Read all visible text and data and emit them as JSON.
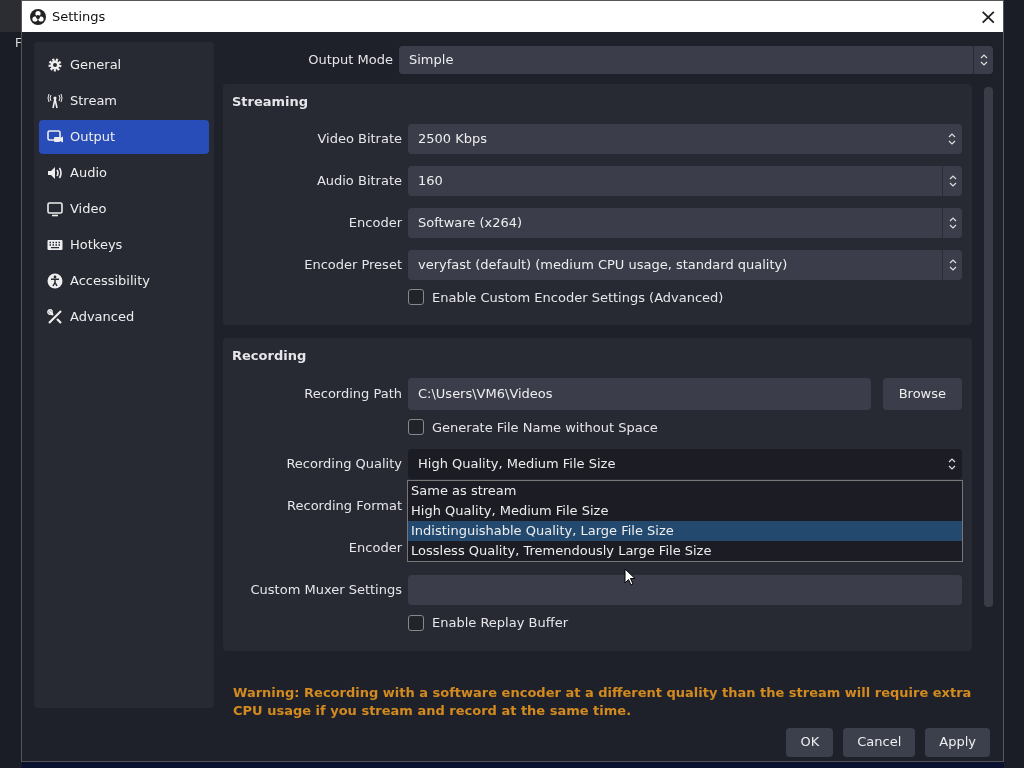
{
  "backdrop": {
    "menu_letter": "F"
  },
  "window": {
    "title": "Settings",
    "close": "×"
  },
  "sidebar": {
    "items": [
      {
        "label": "General",
        "selected": false
      },
      {
        "label": "Stream",
        "selected": false
      },
      {
        "label": "Output",
        "selected": true
      },
      {
        "label": "Audio",
        "selected": false
      },
      {
        "label": "Video",
        "selected": false
      },
      {
        "label": "Hotkeys",
        "selected": false
      },
      {
        "label": "Accessibility",
        "selected": false
      },
      {
        "label": "Advanced",
        "selected": false
      }
    ]
  },
  "output_mode": {
    "label": "Output Mode",
    "value": "Simple"
  },
  "sections": [
    {
      "title": "Streaming",
      "rows": [
        {
          "kind": "spin",
          "label": "Video Bitrate",
          "value": "2500 Kbps"
        },
        {
          "kind": "select",
          "label": "Audio Bitrate",
          "value": "160"
        },
        {
          "kind": "select",
          "label": "Encoder",
          "value": "Software (x264)"
        },
        {
          "kind": "select",
          "label": "Encoder Preset",
          "value": "veryfast (default) (medium CPU usage, standard quality)"
        },
        {
          "kind": "checkbox",
          "label": "Enable Custom Encoder Settings (Advanced)",
          "checked": false
        }
      ]
    },
    {
      "title": "Recording",
      "rows": [
        {
          "kind": "path",
          "label": "Recording Path",
          "value": "C:\\Users\\VM6\\Videos",
          "button": "Browse"
        },
        {
          "kind": "checkbox",
          "label": "Generate File Name without Space",
          "checked": false
        },
        {
          "kind": "dropdown",
          "label": "Recording Quality",
          "value": "High Quality, Medium File Size",
          "options": [
            {
              "label": "Same as stream",
              "highlighted": false
            },
            {
              "label": "High Quality, Medium File Size",
              "highlighted": false
            },
            {
              "label": "Indistinguishable Quality, Large File Size",
              "highlighted": true
            },
            {
              "label": "Lossless Quality, Tremendously Large File Size",
              "highlighted": false
            }
          ]
        },
        {
          "kind": "covered",
          "label": "Recording Format"
        },
        {
          "kind": "covered",
          "label": "Encoder"
        },
        {
          "kind": "text",
          "label": "Custom Muxer Settings"
        },
        {
          "kind": "checkbox",
          "label": "Enable Replay Buffer",
          "checked": false
        }
      ]
    }
  ],
  "warning": "Warning: Recording with a software encoder at a different quality than the stream will require extra CPU usage if you stream and record at the same time.",
  "buttons": [
    "OK",
    "Cancel",
    "Apply"
  ]
}
